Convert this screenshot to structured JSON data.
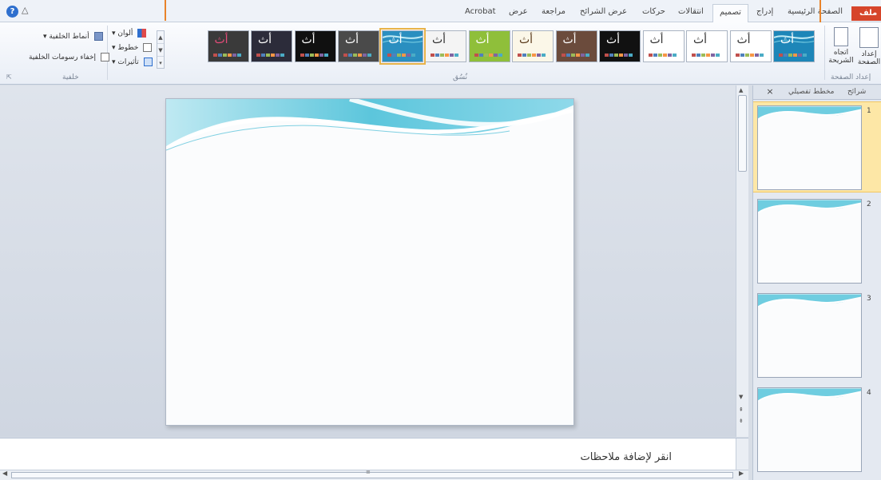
{
  "ribbon_tabs": {
    "acrobat": "Acrobat",
    "view": "عرض",
    "review": "مراجعة",
    "slideshow": "عرض الشرائح",
    "animations": "حركات",
    "transitions": "انتقالات",
    "design": "تصميم",
    "insert": "إدراج",
    "home": "الصفحة الرئيسية",
    "file": "ملف"
  },
  "page_setup_group": {
    "page_setup": "إعداد الصفحة",
    "orientation": "اتجاه الشريحة",
    "label": "إعداد الصفحة"
  },
  "themes_group": {
    "label": "نُسُق",
    "glyph": "أث",
    "themes": [
      {
        "bg": "#1d86b8",
        "fg": "#ffffff",
        "selected": false,
        "wave": true
      },
      {
        "bg": "#ffffff",
        "fg": "#333333",
        "selected": false,
        "wave": false
      },
      {
        "bg": "#ffffff",
        "fg": "#333333",
        "selected": false,
        "wave": false
      },
      {
        "bg": "#ffffff",
        "fg": "#333333",
        "selected": false,
        "wave": false
      },
      {
        "bg": "#111111",
        "fg": "#ffffff",
        "selected": false,
        "wave": false
      },
      {
        "bg": "#6b4b3c",
        "fg": "#ffffff",
        "selected": false,
        "wave": false
      },
      {
        "bg": "#fbf7e8",
        "fg": "#5a3b1c",
        "selected": false,
        "wave": false
      },
      {
        "bg": "#8fbf3a",
        "fg": "#ffffff",
        "selected": false,
        "wave": false
      },
      {
        "bg": "#f4f4f4",
        "fg": "#333333",
        "selected": false,
        "wave": false
      },
      {
        "bg": "#2a8fc0",
        "fg": "#ffffff",
        "selected": true,
        "wave": true
      },
      {
        "bg": "#4a4a4a",
        "fg": "#ffffff",
        "selected": false,
        "wave": false
      },
      {
        "bg": "#101010",
        "fg": "#ffffff",
        "selected": false,
        "wave": false
      },
      {
        "bg": "#2c2c3a",
        "fg": "#ffffff",
        "selected": false,
        "wave": false
      },
      {
        "bg": "#3a3a3a",
        "fg": "#e64c7a",
        "selected": false,
        "wave": false
      }
    ]
  },
  "variants": {
    "colors": "ألوان",
    "fonts": "خطوط",
    "effects": "تأثيرات"
  },
  "background_group": {
    "styles": "أنماط الخلفية",
    "hide_graphics": "إخفاء رسومات الخلفية",
    "label": "خلفية"
  },
  "slides_pane": {
    "tab_slides": "شرائح",
    "tab_outline": "مخطط تفصيلي",
    "close": "×",
    "slides": [
      "1",
      "2",
      "3",
      "4"
    ]
  },
  "notes": {
    "placeholder": "انقر لإضافة ملاحظات"
  },
  "colors": {
    "accent_file": "#d6452a",
    "wave_primary": "#5cc6dc",
    "selection": "#e8b34a"
  }
}
